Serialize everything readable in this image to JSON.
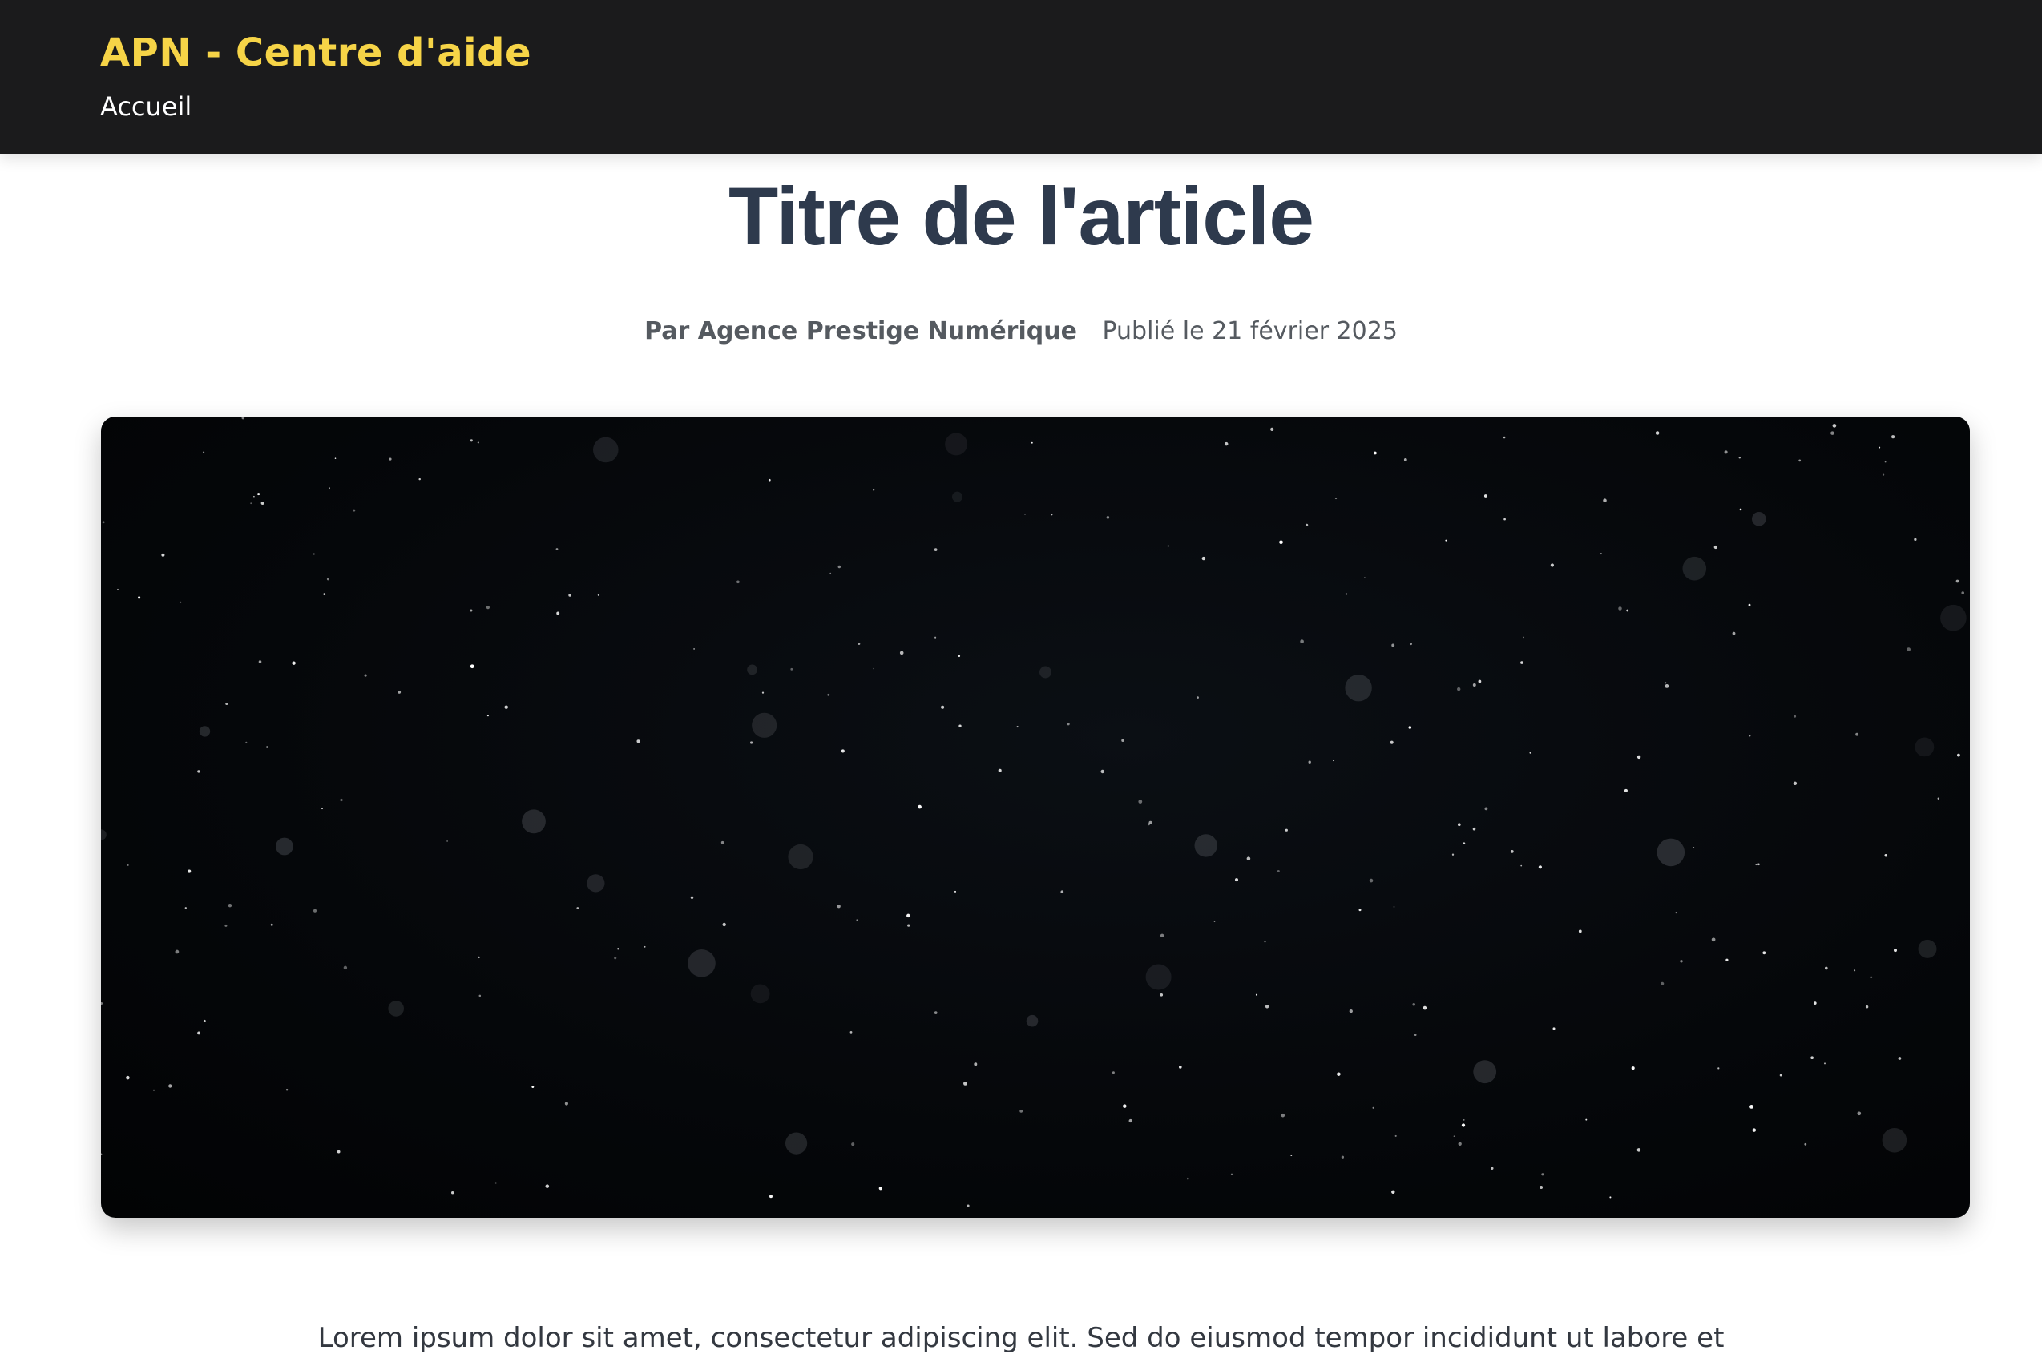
{
  "header": {
    "brand": "APN - Centre d'aide",
    "nav_home": "Accueil"
  },
  "article": {
    "title": "Titre de l'article",
    "author": "Par Agence Prestige Numérique",
    "published": "Publié le 21 février 2025",
    "body_first_line": "Lorem ipsum dolor sit amet, consectetur adipiscing elit. Sed do eiusmod tempor incididunt ut labore et"
  },
  "colors": {
    "header_bg": "#1b1b1c",
    "brand": "#f6d447",
    "title": "#2e3a4d",
    "meta": "#555a60"
  }
}
